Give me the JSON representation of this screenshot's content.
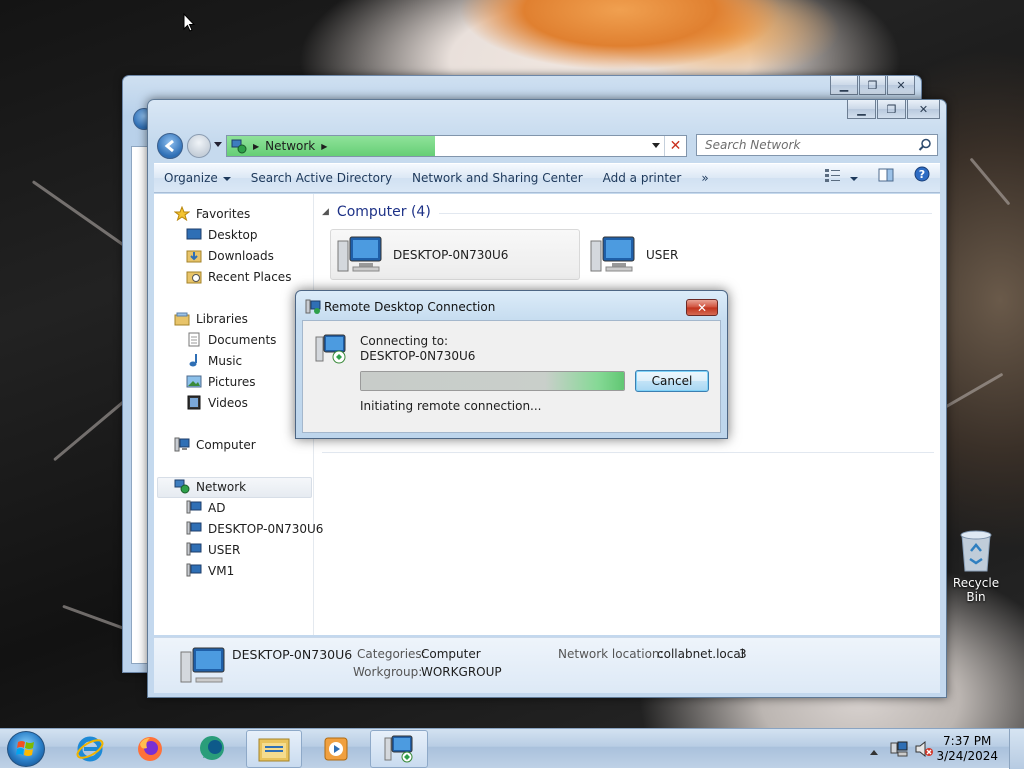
{
  "desktop": {
    "recycle_bin_label": "Recycle Bin"
  },
  "explorer": {
    "address_crumb": "Network",
    "search_placeholder": "Search Network",
    "toolbar": {
      "organize": "Organize",
      "search_ad": "Search Active Directory",
      "nsc": "Network and Sharing Center",
      "add_printer": "Add a printer",
      "more": "»"
    },
    "nav": {
      "favorites": "Favorites",
      "desktop": "Desktop",
      "downloads": "Downloads",
      "recent": "Recent Places",
      "libraries": "Libraries",
      "documents": "Documents",
      "music": "Music",
      "pictures": "Pictures",
      "videos": "Videos",
      "computer": "Computer",
      "network": "Network",
      "network_children": [
        "AD",
        "DESKTOP-0N730U6",
        "USER",
        "VM1"
      ]
    },
    "group_header": "Computer (4)",
    "tiles": [
      {
        "label": "DESKTOP-0N730U6",
        "selected": true
      },
      {
        "label": "USER",
        "selected": false
      }
    ],
    "details": {
      "name": "DESKTOP-0N730U6",
      "categories_label": "Categories:",
      "categories_value": "Computer",
      "workgroup_label": "Workgroup:",
      "workgroup_value": "WORKGROUP",
      "network_location_label": "Network location:",
      "network_location_value": "collabnet.local",
      "network_location_extra": "3"
    }
  },
  "rdc_dialog": {
    "title": "Remote Desktop Connection",
    "close_glyph": "✕",
    "connecting_label": "Connecting to:",
    "target": "DESKTOP-0N730U6",
    "status": "Initiating remote connection...",
    "cancel_label": "Cancel",
    "progress": 1.0
  },
  "taskbar": {
    "time": "7:37 PM",
    "date": "3/24/2024",
    "apps": [
      "internet-explorer",
      "firefox",
      "chat-app",
      "file-explorer",
      "media-player",
      "remote-desktop"
    ]
  },
  "colors": {
    "progress_green": "#61c773",
    "address_fill": "#66cf76",
    "group_header": "#1e3287",
    "close_red": "#c0321c"
  }
}
